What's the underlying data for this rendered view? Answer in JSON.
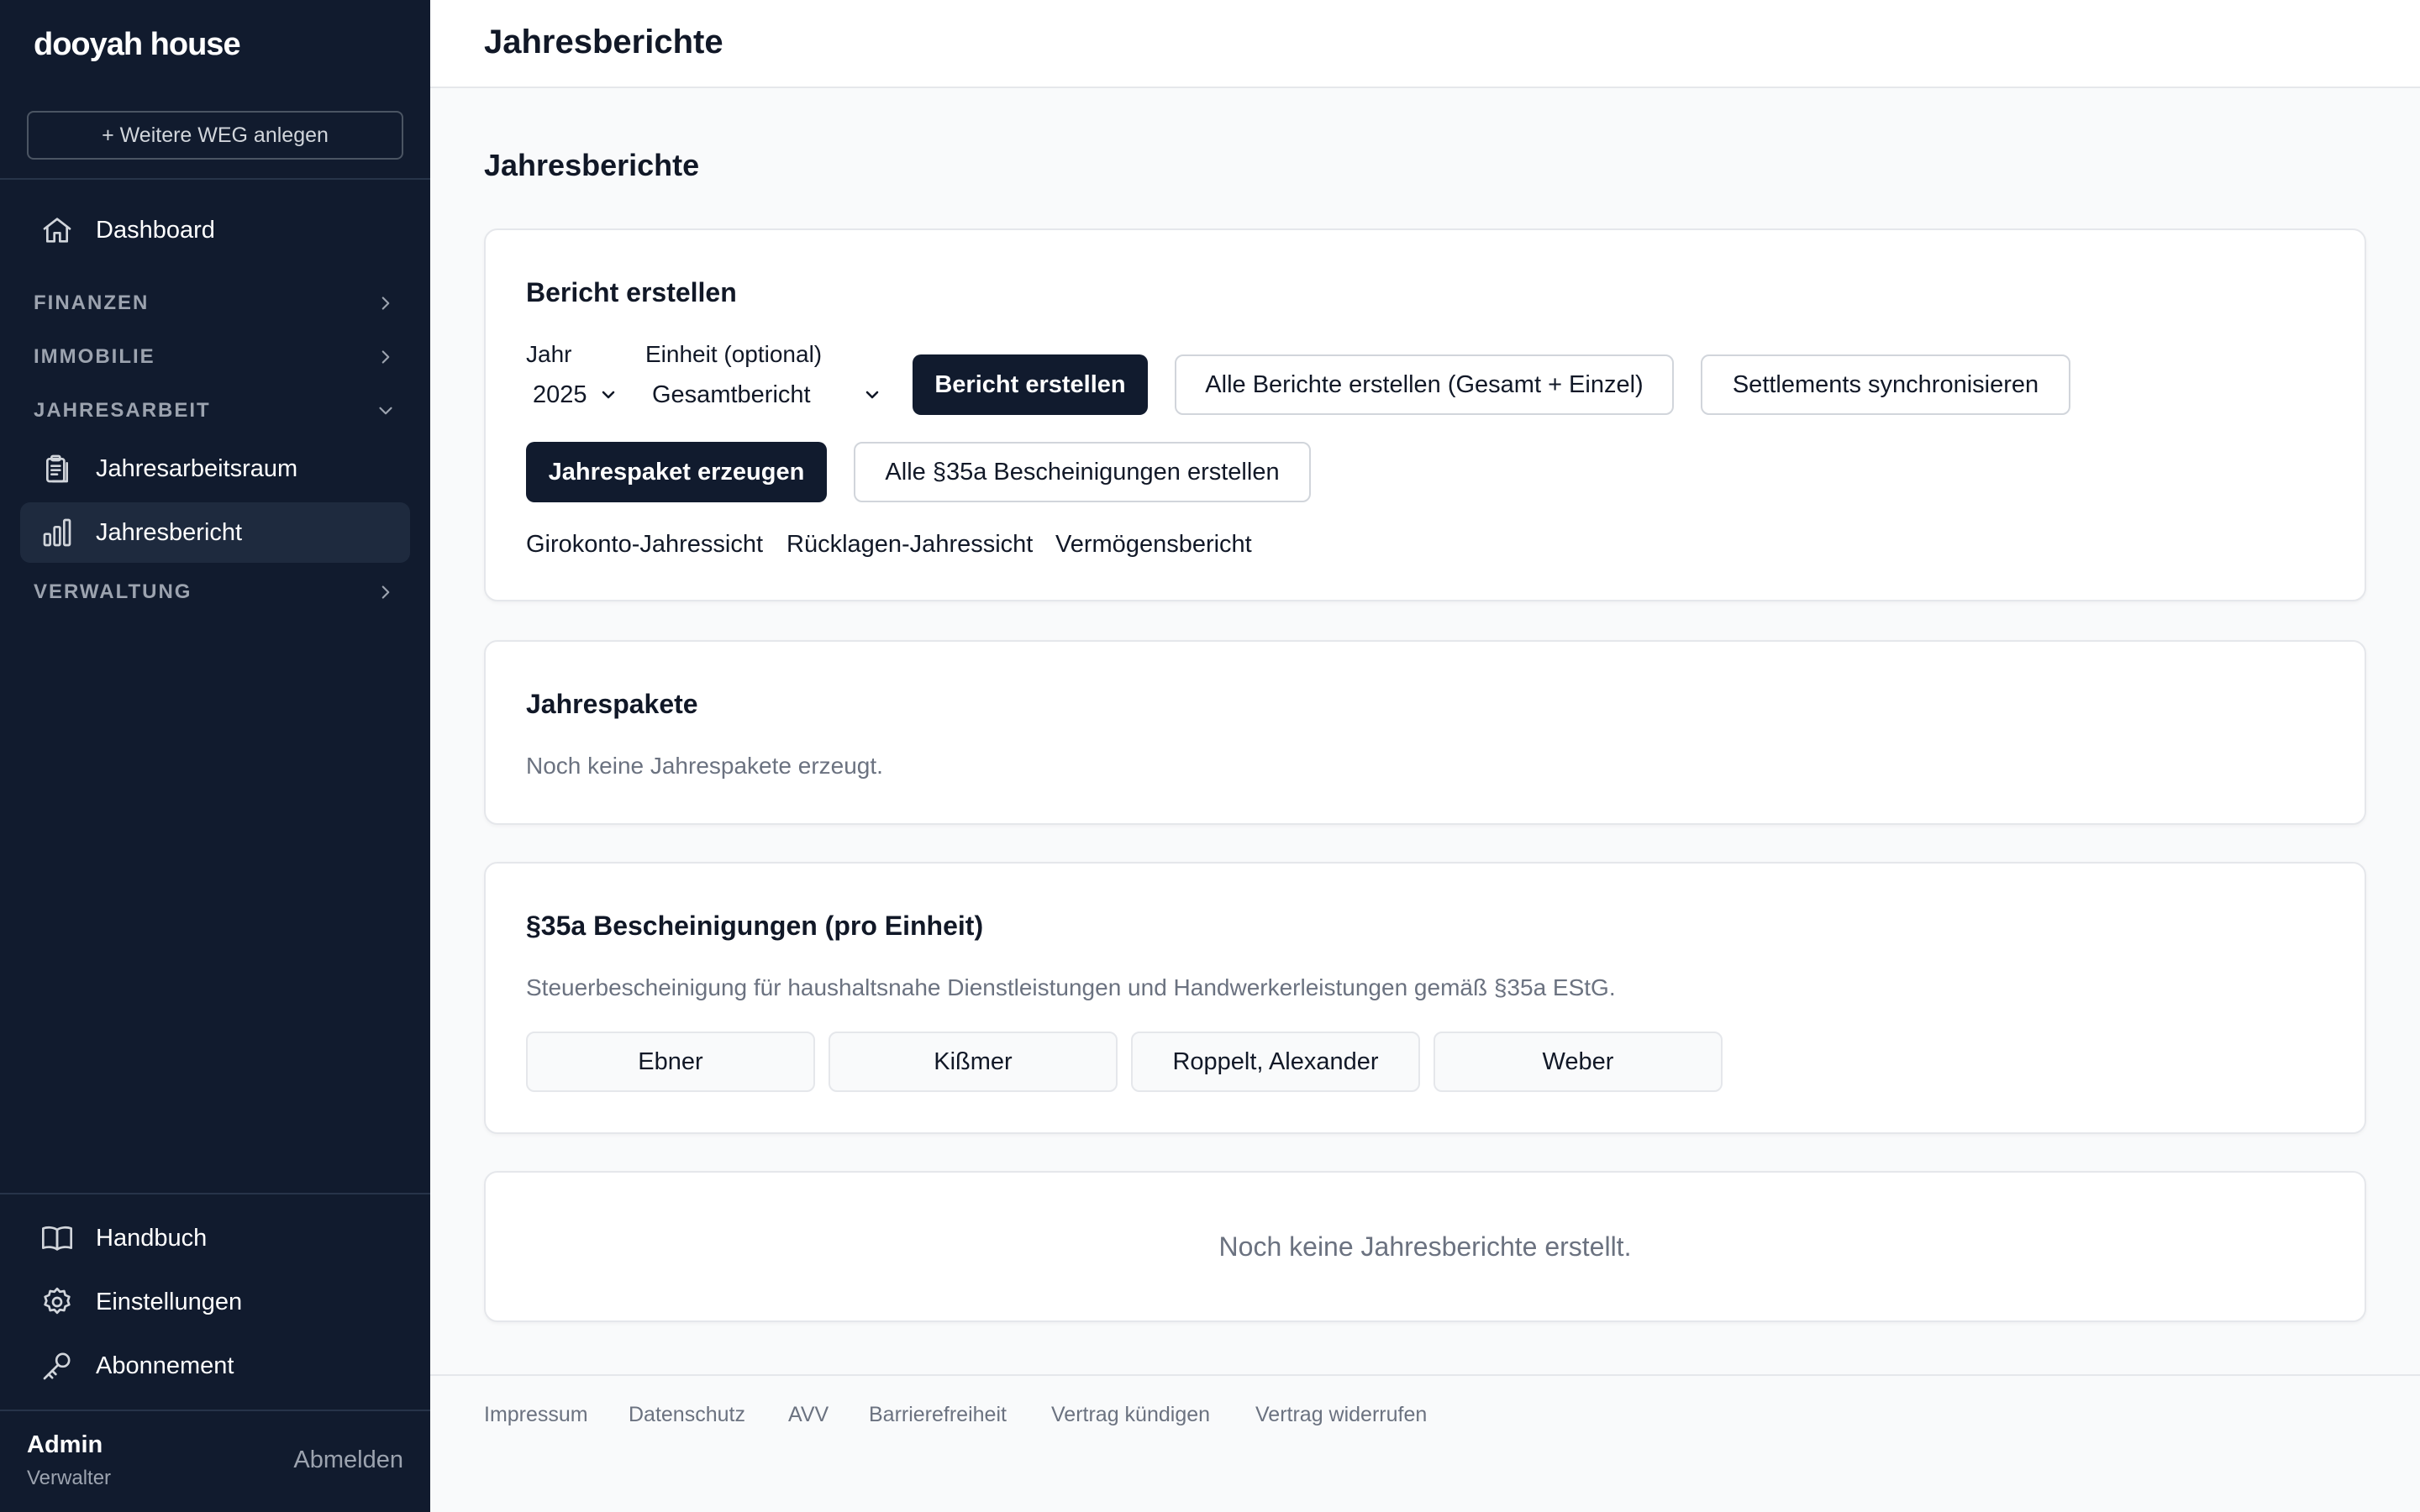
{
  "sidebar": {
    "brand": "dooyah house",
    "add_weg_label": "+ Weitere WEG anlegen",
    "dashboard": "Dashboard",
    "sections": {
      "finanzen": "FINANZEN",
      "immobilie": "IMMOBILIE",
      "jahresarbeit": "JAHRESARBEIT",
      "verwaltung": "VERWALTUNG"
    },
    "jahresarbeit_items": [
      "Jahresarbeitsraum",
      "Jahresbericht"
    ],
    "bottom_items": [
      "Handbuch",
      "Einstellungen",
      "Abonnement"
    ],
    "user": {
      "name": "Admin",
      "role": "Verwalter",
      "logout": "Abmelden"
    }
  },
  "topbar": {
    "title": "Jahresberichte"
  },
  "page": {
    "heading": "Jahresberichte"
  },
  "create_card": {
    "title": "Bericht erstellen",
    "year_label": "Jahr",
    "year_value": "2025",
    "unit_label": "Einheit (optional)",
    "unit_value": "Gesamtbericht",
    "btn_create": "Bericht erstellen",
    "btn_all": "Alle Berichte erstellen (Gesamt + Einzel)",
    "btn_sync": "Settlements synchronisieren",
    "btn_package": "Jahrespaket erzeugen",
    "btn_35a_all": "Alle §35a Bescheinigungen erstellen",
    "links": [
      "Girokonto-Jahressicht",
      "Rücklagen-Jahressicht",
      "Vermögensbericht"
    ]
  },
  "packages_card": {
    "title": "Jahrespakete",
    "empty": "Noch keine Jahrespakete erzeugt."
  },
  "certs_card": {
    "title": "§35a Bescheinigungen (pro Einheit)",
    "description": "Steuerbescheinigung für haushaltsnahe Dienstleistungen und Handwerkerleistungen gemäß §35a EStG.",
    "units": [
      "Ebner",
      "Kißmer",
      "Roppelt, Alexander",
      "Weber"
    ]
  },
  "reports_card": {
    "empty": "Noch keine Jahresberichte erstellt."
  },
  "footer": {
    "links": [
      "Impressum",
      "Datenschutz",
      "AVV",
      "Barrierefreiheit",
      "Vertrag kündigen",
      "Vertrag widerrufen"
    ]
  },
  "colors": {
    "sidebar_bg": "#111b2e",
    "primary_button": "#111b2e",
    "page_bg": "#f9fafb"
  }
}
